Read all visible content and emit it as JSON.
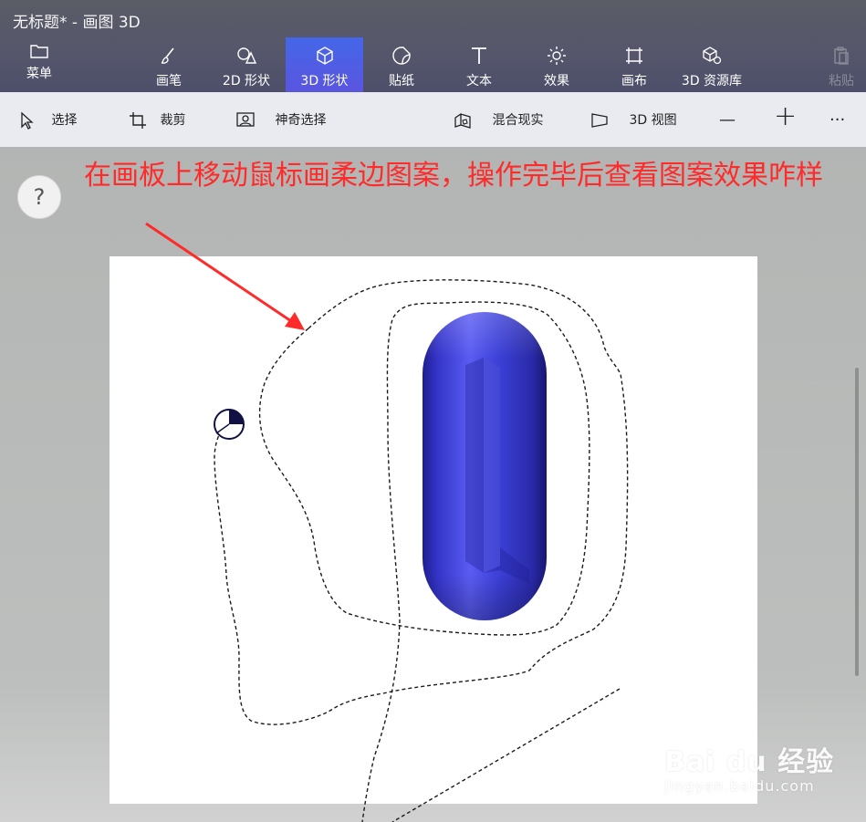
{
  "window": {
    "title": "无标题* - 画图 3D"
  },
  "toolbar": {
    "menu_label": "菜单",
    "tools": [
      {
        "label": "画笔",
        "icon": "brush-icon"
      },
      {
        "label": "2D 形状",
        "icon": "2d-shapes-icon"
      },
      {
        "label": "3D 形状",
        "icon": "3d-shapes-icon",
        "active": true
      },
      {
        "label": "贴纸",
        "icon": "sticker-icon"
      },
      {
        "label": "文本",
        "icon": "text-icon"
      },
      {
        "label": "效果",
        "icon": "effects-icon"
      },
      {
        "label": "画布",
        "icon": "canvas-icon"
      },
      {
        "label": "3D 资源库",
        "icon": "3d-library-icon"
      },
      {
        "label": "粘贴",
        "icon": "paste-icon",
        "disabled": true
      }
    ]
  },
  "subbar": {
    "select": "选择",
    "crop": "裁剪",
    "magic_select": "神奇选择",
    "mixed_reality": "混合现实",
    "view_3d": "3D 视图",
    "zoom_out": "—",
    "zoom_in": "+",
    "more": "···"
  },
  "help": {
    "label": "?"
  },
  "annotation": {
    "text": "在画板上移动鼠标画柔边图案，操作完毕后查看图案效果咋样"
  },
  "watermark": {
    "main": "Bai du 经验",
    "sub": "jingyan.baidu.com"
  },
  "colors": {
    "accent": "#4a63e6",
    "annotation": "#ff2a2a",
    "shape": "#3b3fd0",
    "titlebar": "#55566b"
  }
}
